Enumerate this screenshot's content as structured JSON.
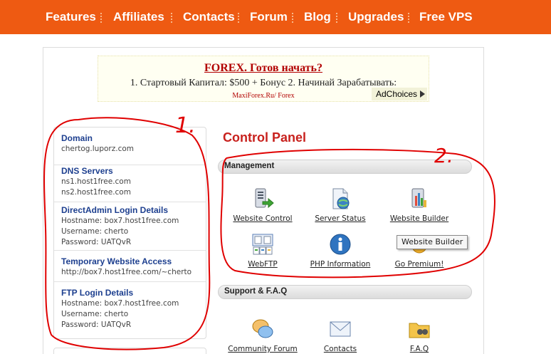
{
  "nav": {
    "items": [
      {
        "label": "Features"
      },
      {
        "label": "Affiliates"
      },
      {
        "label": "Contacts"
      },
      {
        "label": "Forum"
      },
      {
        "label": "Blog"
      },
      {
        "label": "Upgrades"
      },
      {
        "label": "Free VPS"
      }
    ]
  },
  "ad": {
    "title": "FOREX. Готов начать?",
    "text": "1. Стартовый Капитал: $500 + Бонус 2. Начинай Зарабатывать:",
    "url": "MaxiForex.Ru/  Forex",
    "choices": "AdChoices"
  },
  "info": {
    "domain": {
      "title": "Domain",
      "lines": [
        "chertog.luporz.com"
      ]
    },
    "dns": {
      "title": "DNS Servers",
      "lines": [
        "ns1.host1free.com",
        "ns2.host1free.com"
      ]
    },
    "directadmin": {
      "title": "DirectAdmin Login Details",
      "lines": [
        "Hostname: box7.host1free.com",
        "Username: cherto",
        "Password: UATQvR"
      ]
    },
    "temp": {
      "title": "Temporary Website Access",
      "lines": [
        "http://box7.host1free.com/~cherto"
      ]
    },
    "ftp": {
      "title": "FTP Login Details",
      "lines": [
        "Hostname: box7.host1free.com",
        "Username: cherto",
        "Password: UATQvR"
      ]
    }
  },
  "control_panel": {
    "title": "Control Panel",
    "management": {
      "label": "Management",
      "tools": [
        {
          "label": "Website Control",
          "icon": "website-control-icon"
        },
        {
          "label": "Server Status",
          "icon": "server-status-icon"
        },
        {
          "label": "Website Builder",
          "icon": "website-builder-icon"
        },
        {
          "label": "WebFTP",
          "icon": "webftp-icon"
        },
        {
          "label": "PHP Information",
          "icon": "php-info-icon"
        },
        {
          "label": "Go Premium!",
          "icon": "go-premium-icon"
        }
      ]
    },
    "support": {
      "label": "Support & F.A.Q",
      "tools": [
        {
          "label": "Community Forum",
          "icon": "community-forum-icon"
        },
        {
          "label": "Contacts",
          "icon": "contacts-mail-icon"
        },
        {
          "label": "F.A.Q",
          "icon": "faq-folder-icon"
        }
      ]
    },
    "tooltip": "Website Builder"
  },
  "annotations": {
    "one": "1.",
    "two": "2."
  },
  "colors": {
    "nav": "#ee5a12",
    "heading": "#c8211d",
    "link": "#1d3f8f",
    "annotation": "#e00000"
  }
}
